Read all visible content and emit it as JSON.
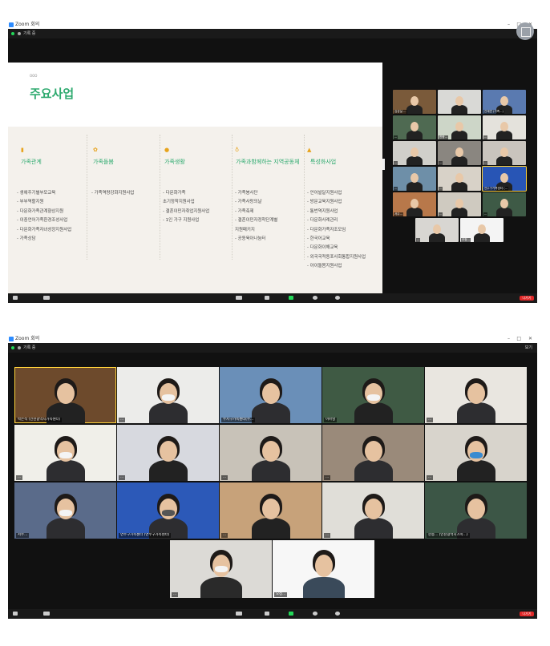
{
  "window1": {
    "title": "Zoom 회의",
    "recording_label": "기록 중",
    "end_label": "나가기",
    "slide": {
      "small_label": "OOO",
      "title": "주요사업",
      "columns": [
        {
          "heading": "가족관계",
          "items": [
            "- 생애주기별부모교육",
            "- 부부역할지원",
            "- 다문화가족관계향상지원",
            "- 이중언어가족환경조성사업",
            "- 다문화가족자녀성장지원사업",
            "- 가족상담"
          ]
        },
        {
          "heading": "가족돌봄",
          "items": [
            "- 가족역량강화지원사업"
          ]
        },
        {
          "heading": "가족생활",
          "items": [
            "- 다문화가족",
            "  초기정착지원사업",
            "- 결혼이민자취업지원사업",
            "- 1인 가구 지원사업"
          ]
        },
        {
          "heading": "가족과함께하는 지역공동체",
          "items": [
            "- 가족봉사단",
            "- 가족사랑의날",
            "- 가족축제",
            "- 결혼이민자정착단계별",
            "  지원패키지",
            "- 공동육아나눔터"
          ]
        },
        {
          "heading": "특성화사업",
          "items": [
            "- 언어발달지원사업",
            "- 방문교육지원사업",
            "- 통번역지원사업",
            "- 다문화사례관리",
            "- 다문화가족자조모임",
            "- 한국어교육",
            "- 다문화이해교육",
            "- 외국국적동포사회통합지원사업",
            "- 아이돌봄지원사업"
          ]
        }
      ]
    },
    "thumbs": [
      {
        "name": "김성실 ..."
      },
      {
        "name": ""
      },
      {
        "name": "관계연 (가족...)"
      },
      {
        "name": "..."
      },
      {
        "name": "한종..."
      },
      {
        "name": "..."
      },
      {
        "name": "..."
      },
      {
        "name": "..."
      },
      {
        "name": "..."
      },
      {
        "name": "..."
      },
      {
        "name": "..."
      },
      {
        "name": "연수구가족센터 (..."
      },
      {
        "name": "서수..."
      },
      {
        "name": "..."
      },
      {
        "name": "..."
      },
      {
        "name": "..."
      },
      {
        "name": "오정..."
      }
    ]
  },
  "window2": {
    "title": "Zoom 회의",
    "recording_label": "기록 중",
    "view_label": "보기",
    "end_label": "나가기",
    "tiles": [
      {
        "name": "박은석 (인천광역시가족센터)"
      },
      {
        "name": "..."
      },
      {
        "name": "수지구가족센터(수..."
      },
      {
        "name": "이아영"
      },
      {
        "name": "..."
      },
      {
        "name": "..."
      },
      {
        "name": "..."
      },
      {
        "name": "..."
      },
      {
        "name": "..."
      },
      {
        "name": "..."
      },
      {
        "name": "서수..."
      },
      {
        "name": "연수구가족센터 (연수구가족센터)"
      },
      {
        "name": "..."
      },
      {
        "name": "..."
      },
      {
        "name": "한종... (인천광역시가족...)"
      },
      {
        "name": "..."
      },
      {
        "name": "오정..."
      }
    ]
  },
  "icons": [
    "zoom-logo-icon",
    "shield-icon",
    "record-icon",
    "mic-icon",
    "video-icon",
    "participants-icon",
    "chat-icon",
    "share-screen-icon",
    "record-button-icon",
    "reactions-icon"
  ]
}
